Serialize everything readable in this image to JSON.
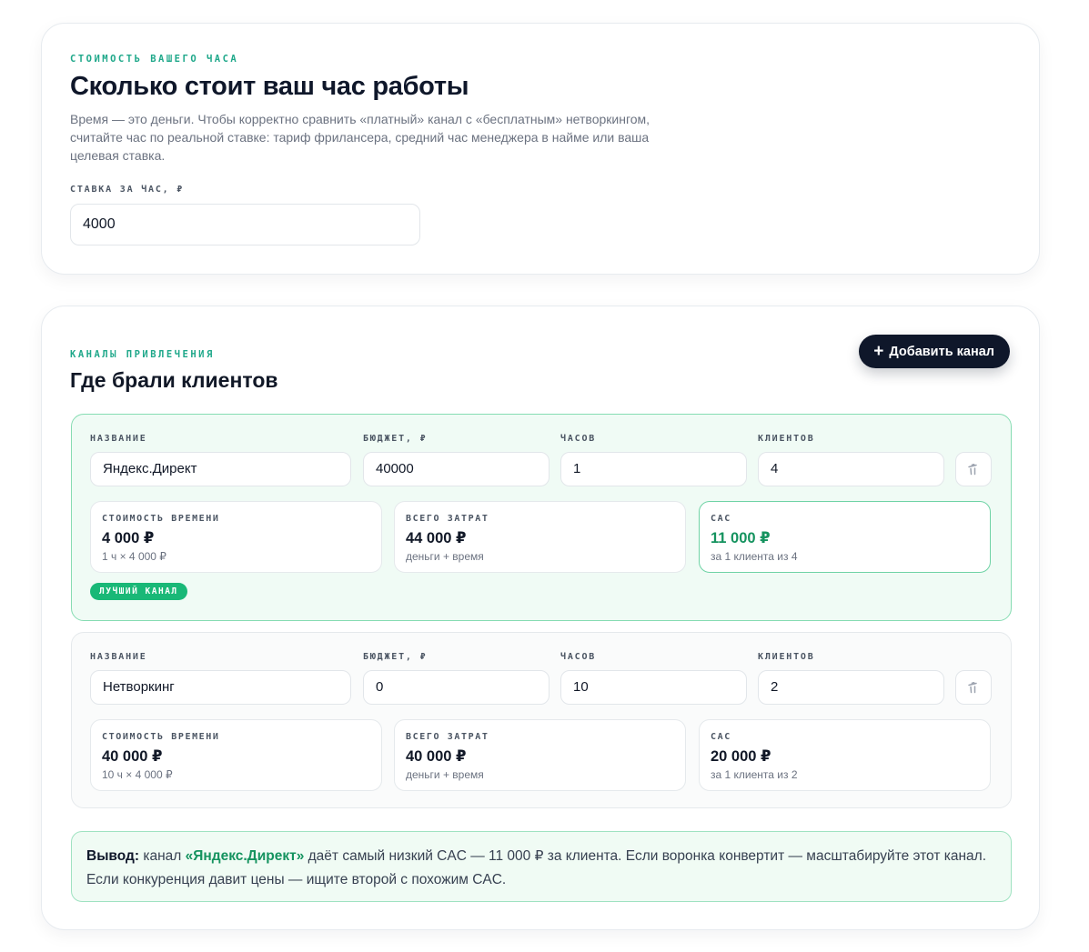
{
  "rate_section": {
    "eyebrow": "СТОИМОСТЬ ВАШЕГО ЧАСА",
    "title": "Сколько стоит ваш час работы",
    "description": "Время — это деньги. Чтобы корректно сравнить «платный» канал с «бесплатным» нетворкингом, считайте час по реальной ставке: тариф фрилансера, средний час менеджера в найме или ваша целевая ставка.",
    "rate_label": "СТАВКА ЗА ЧАС, ₽",
    "rate_value": "4000"
  },
  "channels_section": {
    "eyebrow": "КАНАЛЫ ПРИВЛЕЧЕНИЯ",
    "title": "Где брали клиентов",
    "add_button_label": "Добавить канал",
    "add_button_icon": "plus-icon",
    "field_labels": {
      "name": "НАЗВАНИЕ",
      "budget": "БЮДЖЕТ, ₽",
      "hours": "ЧАСОВ",
      "clients": "КЛИЕНТОВ"
    },
    "metric_labels": {
      "time_cost": "СТОИМОСТЬ ВРЕМЕНИ",
      "total_cost": "ВСЕГО ЗАТРАТ",
      "cac": "CAC"
    },
    "channels": [
      {
        "name": "Яндекс.Директ",
        "budget": "40000",
        "hours": "1",
        "clients": "4",
        "time_cost": "4 000 ₽",
        "time_cost_sub": "1 ч × 4 000 ₽",
        "total_cost": "44 000 ₽",
        "total_cost_sub": "деньги + время",
        "cac": "11 000 ₽",
        "cac_sub": "за 1 клиента из 4",
        "badge": "ЛУЧШИЙ КАНАЛ",
        "best": true
      },
      {
        "name": "Нетворкинг",
        "budget": "0",
        "hours": "10",
        "clients": "2",
        "time_cost": "40 000 ₽",
        "time_cost_sub": "10 ч × 4 000 ₽",
        "total_cost": "40 000 ₽",
        "total_cost_sub": "деньги + время",
        "cac": "20 000 ₽",
        "cac_sub": "за 1 клиента из 2",
        "best": false
      }
    ],
    "conclusion": {
      "lead": "Вывод:",
      "part1": " канал ",
      "channel": "«Яндекс.Директ»",
      "part2": " даёт самый низкий CAC — 11 000 ₽ за клиента. Если воронка конвертит — масштабируйте этот канал. Если конкуренция давит цены — ищите второй с похожим CAC."
    }
  },
  "colors": {
    "accent": "#1fa88a",
    "best_border": "#86dcb2",
    "best_bg": "#f0fbf5",
    "badge": "#19b877",
    "cac_best_text": "#15935f",
    "dark_button": "#0f172a"
  }
}
